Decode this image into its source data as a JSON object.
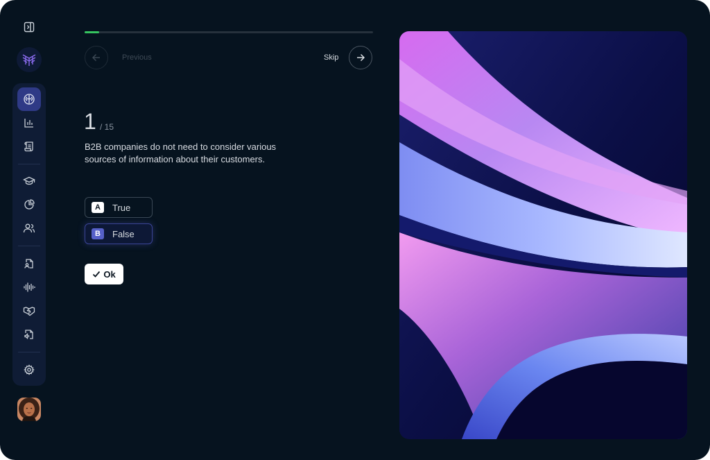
{
  "nav": {
    "collapse_icon": "sidebar-collapse-icon",
    "logo_icon": "app-logo-icon",
    "items": [
      {
        "icon": "brain-icon",
        "active": true
      },
      {
        "icon": "bar-chart-icon",
        "active": false
      },
      {
        "icon": "scroll-icon",
        "active": false
      },
      {
        "icon": "graduation-cap-icon",
        "active": false
      },
      {
        "icon": "pie-chart-icon",
        "active": false
      },
      {
        "icon": "users-icon",
        "active": false
      },
      {
        "icon": "file-user-icon",
        "active": false
      },
      {
        "icon": "audio-wave-icon",
        "active": false
      },
      {
        "icon": "handshake-icon",
        "active": false
      },
      {
        "icon": "file-audio-icon",
        "active": false
      },
      {
        "icon": "settings-icon",
        "active": false
      }
    ],
    "avatar": "user-avatar"
  },
  "quiz": {
    "progress": 0.05,
    "previous_label": "Previous",
    "skip_label": "Skip",
    "question_number": "1",
    "question_total": "/ 15",
    "question_text": "B2B companies do not need to consider various sources of information about their customers.",
    "options": [
      {
        "key": "A",
        "label": "True"
      },
      {
        "key": "B",
        "label": "False"
      }
    ],
    "ok_label": "Ok"
  },
  "colors": {
    "background": "#06131f",
    "sidebar": "#0f1c35",
    "accent": "#2f3a86",
    "progress": "#36c460"
  }
}
